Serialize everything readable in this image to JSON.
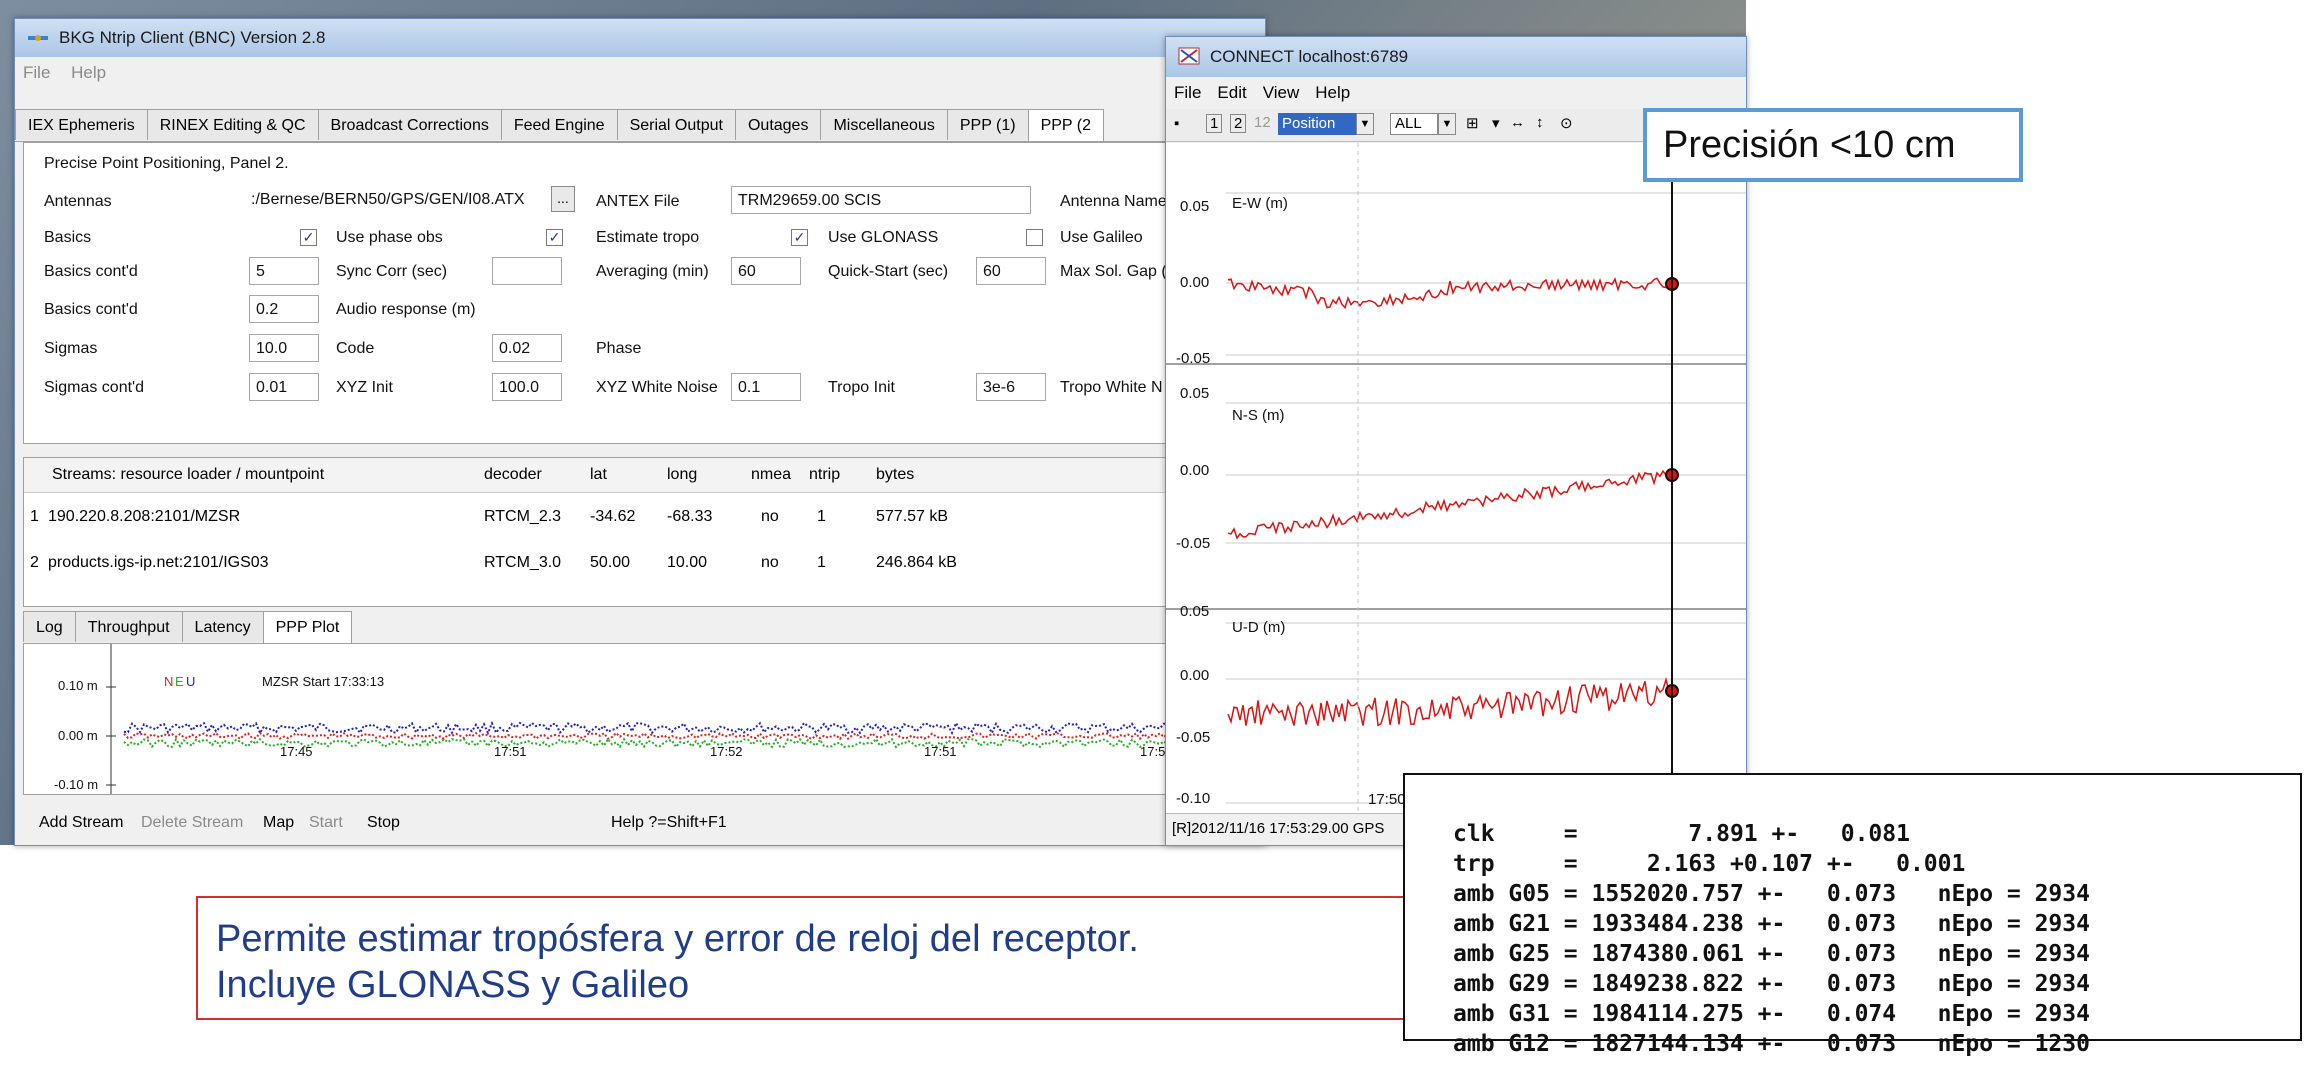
{
  "bnc": {
    "title": "BKG Ntrip Client (BNC) Version 2.8",
    "menu": [
      "File",
      "Help"
    ],
    "tabs": [
      "IEX Ephemeris",
      "RINEX Editing & QC",
      "Broadcast Corrections",
      "Feed Engine",
      "Serial Output",
      "Outages",
      "Miscellaneous",
      "PPP (1)",
      "PPP (2"
    ],
    "panel_heading": "Precise Point Positioning, Panel 2.",
    "form": {
      "antennas_label": "Antennas",
      "antennas_path": ":/Bernese/BERN50/GPS/GEN/I08.ATX",
      "browse": "...",
      "antex_label": "ANTEX File",
      "antex_value": "TRM29659.00    SCIS",
      "antenna_name_label": "Antenna Name",
      "basics_label": "Basics",
      "use_phase_obs": "Use phase obs",
      "estimate_tropo": "Estimate tropo",
      "use_glonass": "Use GLONASS",
      "use_galileo": "Use Galileo",
      "basics_cont_label": "Basics cont'd",
      "basics_cont_value": "5",
      "sync_corr_label": "Sync Corr (sec)",
      "sync_corr_value": "",
      "averaging_label": "Averaging (min)",
      "averaging_value": "60",
      "quick_start_label": "Quick-Start (sec)",
      "quick_start_value": "60",
      "max_sol_gap_label": "Max Sol. Gap (",
      "basics_cont2_label": "Basics cont'd",
      "basics_cont2_value": "0.2",
      "audio_label": "Audio response (m)",
      "sigmas_label": "Sigmas",
      "sigmas_value": "10.0",
      "code_label": "Code",
      "code_value": "0.02",
      "phase_label": "Phase",
      "sigmas_cont_label": "Sigmas cont'd",
      "sigmas_cont_value": "0.01",
      "xyz_init_label": "XYZ Init",
      "xyz_init_value": "100.0",
      "xyz_white_label": "XYZ White Noise",
      "xyz_white_value": "0.1",
      "tropo_init_label": "Tropo Init",
      "tropo_init_value": "3e-6",
      "tropo_white_label": "Tropo White N"
    },
    "streams": {
      "headers": [
        "Streams:  resource loader / mountpoint",
        "decoder",
        "lat",
        "long",
        "nmea",
        "ntrip",
        "bytes"
      ],
      "rows": [
        {
          "idx": "1",
          "mount": "190.220.8.208:2101/MZSR",
          "decoder": "RTCM_2.3",
          "lat": "-34.62",
          "long": "-68.33",
          "nmea": "no",
          "ntrip": "1",
          "bytes": "577.57 kB"
        },
        {
          "idx": "2",
          "mount": "products.igs-ip.net:2101/IGS03",
          "decoder": "RTCM_3.0",
          "lat": "50.00",
          "long": "10.00",
          "nmea": "no",
          "ntrip": "1",
          "bytes": "246.864 kB"
        }
      ]
    },
    "bottom_tabs": [
      "Log",
      "Throughput",
      "Latency",
      "PPP Plot"
    ],
    "ppp_plot": {
      "legend_n": "N",
      "legend_e": "E",
      "legend_u": "U",
      "start": "MZSR Start 17:33:13",
      "y_ticks": [
        "0.10 m",
        "0.00 m",
        "-0.10 m"
      ],
      "x_ticks": [
        "17:45",
        "17:51",
        "17:52",
        "17:51",
        "17:52",
        "17:5"
      ],
      "colors": {
        "n": "#e02020",
        "e": "#20b020",
        "u": "#2020d0"
      }
    },
    "footer": [
      "Add Stream",
      "Delete Stream",
      "Map",
      "Start",
      "Stop",
      "Help ?=Shift+F1"
    ]
  },
  "connect": {
    "title": "CONNECT localhost:6789",
    "menu": [
      "File",
      "Edit",
      "View",
      "Help"
    ],
    "toolbar": {
      "btn1": "1",
      "btn2": "2",
      "btn3": "12",
      "position": "Position",
      "all": "ALL"
    },
    "plots": [
      {
        "title": "E-W (m)",
        "ticks": [
          "0.05",
          "0.00",
          "-0.05"
        ]
      },
      {
        "title": "N-S (m)",
        "ticks": [
          "0.05",
          "0.00",
          "-0.05"
        ]
      },
      {
        "title": "U-D (m)",
        "ticks": [
          "0.05",
          "0.00",
          "-0.05",
          "-0.10"
        ]
      }
    ],
    "x_tick": "17:50",
    "status": "[R]2012/11/16 17:53:29.00 GPS",
    "line_color": "#e01010"
  },
  "callout_precision": "Precisión <10 cm",
  "callout_description": [
    "Permite estimar tropósfera y error de reloj del receptor.",
    "Incluye GLONASS y Galileo"
  ],
  "console_lines": [
    "clk     =        7.891 +-   0.081",
    "trp     =     2.163 +0.107 +-   0.001",
    "amb G05 = 1552020.757 +-   0.073   nEpo = 2934",
    "amb G21 = 1933484.238 +-   0.073   nEpo = 2934",
    "amb G25 = 1874380.061 +-   0.073   nEpo = 2934",
    "amb G29 = 1849238.822 +-   0.073   nEpo = 2934",
    "amb G31 = 1984114.275 +-   0.074   nEpo = 2934",
    "amb G12 = 1827144.134 +-   0.073   nEpo = 1230"
  ]
}
